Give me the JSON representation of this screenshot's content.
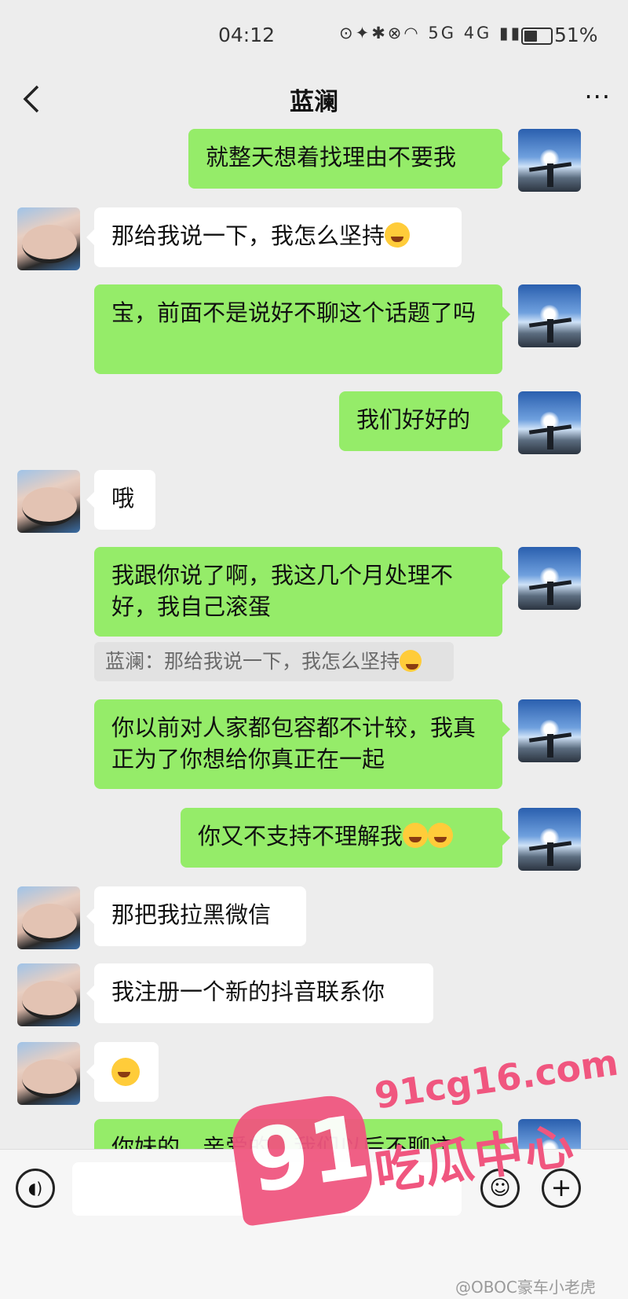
{
  "status": {
    "time": "04:12",
    "battery": "51%",
    "battery_level": 0.51,
    "signal_text": "5G 4G"
  },
  "header": {
    "title": "蓝澜",
    "more": "···"
  },
  "messages": [
    {
      "from": "me",
      "text": "就整天想着找理由不要我",
      "emoji": ""
    },
    {
      "from": "her",
      "text": "那给我说一下，我怎么坚持",
      "emoji": "grinning-squinting-emoji"
    },
    {
      "from": "me",
      "text": "宝，前面不是说好不聊这个话题了吗",
      "emoji": ""
    },
    {
      "from": "me",
      "text": "我们好好的",
      "emoji": ""
    },
    {
      "from": "her",
      "text": "哦",
      "emoji": ""
    },
    {
      "from": "me",
      "text": "我跟你说了啊，我这几个月处理不好，我自己滚蛋",
      "emoji": ""
    },
    {
      "from": "me",
      "text": "你以前对人家都包容都不计较，我真正为了你想给你真正在一起",
      "emoji": ""
    },
    {
      "from": "me",
      "text": "你又不支持不理解我",
      "emoji": "angry-crying-emoji"
    },
    {
      "from": "her",
      "text": "那把我拉黑微信",
      "emoji": ""
    },
    {
      "from": "her",
      "text": "我注册一个新的抖音联系你",
      "emoji": ""
    },
    {
      "from": "her",
      "text": "",
      "emoji": "grinning-emoji"
    },
    {
      "from": "me",
      "text": "你妹的，亲爱的，我们以后不聊这",
      "emoji": ""
    }
  ],
  "quote": {
    "text": "蓝澜：那给我说一下，我怎么坚持"
  },
  "watermark": {
    "logo": "91",
    "site": "91cg16.com",
    "name": "吃瓜中心",
    "credit": "@OBOC豪车小老虎"
  },
  "colors": {
    "me_bubble": "#95ec69",
    "her_bubble": "#ffffff",
    "background": "#ededed",
    "watermark": "#f0567f"
  },
  "icons": {
    "back": "chevron-left-icon",
    "voice": "voice-icon",
    "emoji": "smile-icon",
    "plus": "plus-icon"
  }
}
